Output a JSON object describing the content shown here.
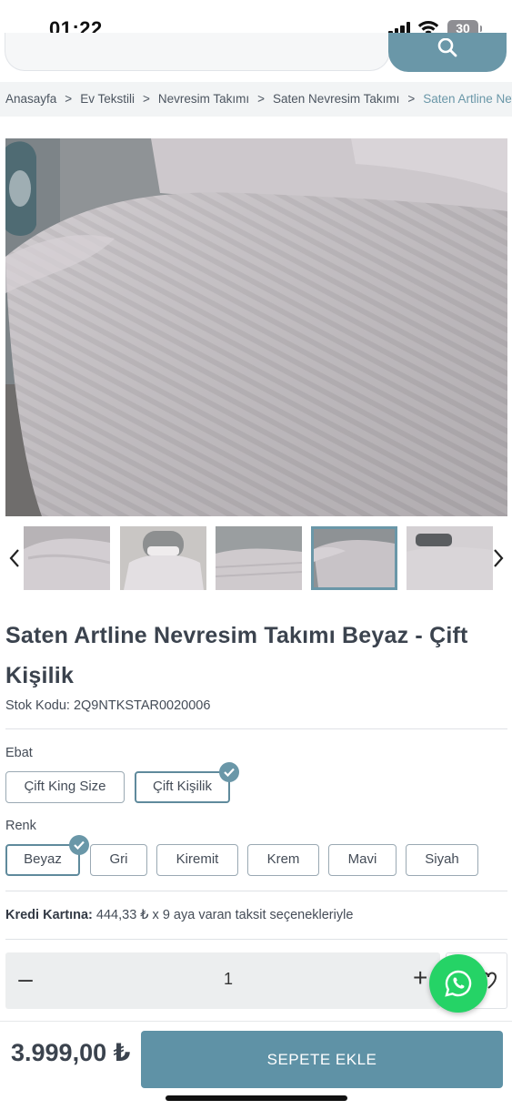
{
  "status_bar": {
    "time": "01:22",
    "battery": "30"
  },
  "search": {
    "placeholder": ""
  },
  "breadcrumb": {
    "items": [
      "Anasayfa",
      "Ev Tekstili",
      "Nevresim Takımı",
      "Saten Nevresim Takımı"
    ],
    "current": "Saten Artline Nevresim Takımı Beyaz - Çift Kişilik",
    "separator": ">"
  },
  "product": {
    "title": "Saten Artline Nevresim Takımı Beyaz - Çift Kişilik",
    "stock_label": "Stok Kodu:",
    "stock_code": "2Q9NTKSTAR0020006",
    "size_label": "Ebat",
    "sizes": [
      {
        "label": "Çift King Size",
        "selected": false
      },
      {
        "label": "Çift Kişilik",
        "selected": true
      }
    ],
    "color_label": "Renk",
    "colors": [
      {
        "label": "Beyaz",
        "selected": true
      },
      {
        "label": "Gri",
        "selected": false
      },
      {
        "label": "Kiremit",
        "selected": false
      },
      {
        "label": "Krem",
        "selected": false
      },
      {
        "label": "Mavi",
        "selected": false
      },
      {
        "label": "Siyah",
        "selected": false
      }
    ],
    "credit_label": "Kredi Kartına:",
    "credit_text": "444,33 ₺ x 9 aya varan taksit seçenekleriyle",
    "quantity": "1",
    "price": "3.999,00 ₺",
    "add_to_cart": "SEPETE EKLE"
  },
  "gallery": {
    "thumbnail_count": 5,
    "active_index": 3
  },
  "colors": {
    "accent": "#6a97a8",
    "whatsapp": "#25d366",
    "text": "#3b434e"
  },
  "icons": {
    "search": "search-icon",
    "prev": "chevron-left-icon",
    "next": "chevron-right-icon",
    "check": "check-icon",
    "whatsapp": "whatsapp-icon"
  }
}
